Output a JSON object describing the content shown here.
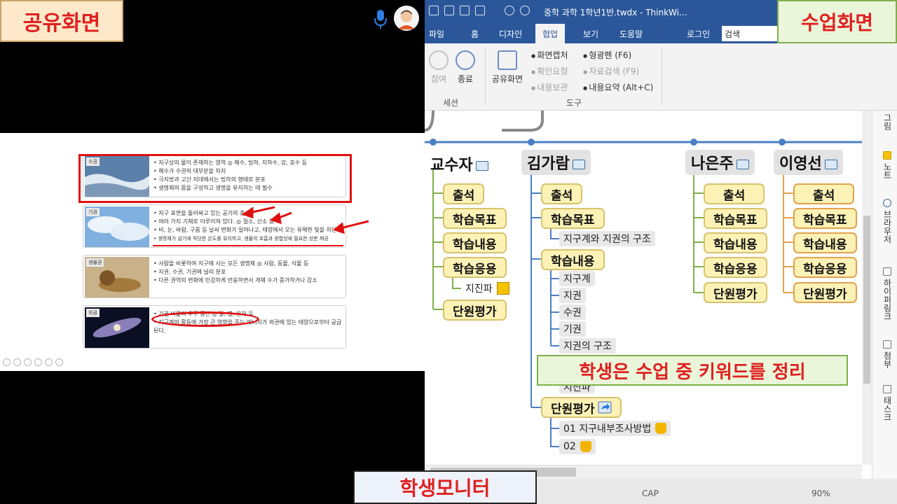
{
  "labels": {
    "share_screen": "공유화면",
    "class_screen": "수업화면",
    "student_monitor": "학생모니터",
    "keyword_note": "학생은 수업 중 키워드를 정리"
  },
  "app": {
    "title": "중학 과학 1학년1반.twdx - ThinkWi...",
    "menu": [
      "파일",
      "홈",
      "디자인",
      "협업",
      "보기",
      "도움말",
      "로그인"
    ],
    "active_menu": "협업",
    "search_placeholder": "검색",
    "ribbon": {
      "join": "참여",
      "end": "종료",
      "share_screen": "공유화면",
      "session_group": "세션",
      "tools_group": "도구",
      "tools": [
        {
          "label": "화면캡처",
          "enabled": true
        },
        {
          "label": "확인요청",
          "enabled": false
        },
        {
          "label": "내용보관",
          "enabled": false
        },
        {
          "label": "형광펜 (F6)",
          "enabled": true
        },
        {
          "label": "자료검색 (F9)",
          "enabled": false
        },
        {
          "label": "내용요약 (Alt+C)",
          "enabled": true
        }
      ]
    },
    "side_panel": [
      "그림",
      "노트",
      "브라우저",
      "하이퍼링크",
      "첨부",
      "태스크"
    ],
    "status": {
      "cap": "CAP",
      "zoom": "90%"
    }
  },
  "slide": {
    "cards": [
      {
        "tag": "수권",
        "lines": [
          "지구상의 물이 존재하는 영역 ◎ 해수, 빙하, 지하수, 강, 호수 등",
          "해수가 수권의 대부분을 차지",
          "극지방과 고산 지대에서는 빙하의 형태로 분포",
          "생명체의 몸을 구성하고 생명을 유지하는 데 필수"
        ]
      },
      {
        "tag": "기권",
        "lines": [
          "지구 표면을 둘러싸고 있는 공기의 층",
          "여러 가지 기체로 이루어져 있다. ◎ 질소, 산소 등",
          "비, 눈, 바람, 구름 등 날씨 변화가 일어나고, 태양에서 오는 유해한 빛을 차단",
          "생명체가 살기에 적당한 온도를 유지하고, 생물의 호흡과 광합성에 필요한 성분 제공"
        ]
      },
      {
        "tag": "생물권",
        "lines": [
          "사람을 비롯하여 지구에 사는 모든 생명체 ◎ 사람, 동물, 식물 등",
          "지권, 수권, 기권에 널리 분포",
          "다른 권역의 변화에 민감하게 반응하면서 개체 수가 증가하거나 감소"
        ]
      },
      {
        "tag": "외권",
        "lines": [
          "기권 바깥의 우주 공간 ◎ 달, 별, 은하 등",
          "지구계의 활동에 가장 큰 영향을 주는 에너지가 외권에 있는 태양으로부터 공급된다."
        ]
      }
    ]
  },
  "mindmap": {
    "columns": [
      {
        "name": "교수자",
        "nodes": [
          "출석",
          "학습목표",
          "학습내용",
          "학습응용",
          "단원평가"
        ],
        "leaf": "지진파"
      },
      {
        "name": "김가람",
        "nodes": [
          "출석",
          "학습목표",
          "학습내용",
          "단원평가"
        ],
        "goal_leaf": "지구계와 지권의 구조",
        "content_leaves": [
          "지구계",
          "지권",
          "수권",
          "기권",
          "지권의 구조",
          "지진파"
        ],
        "eval_leaves": [
          "01  지구내부조사방법",
          "02"
        ]
      },
      {
        "name": "나은주",
        "nodes": [
          "출석",
          "학습목표",
          "학습내용",
          "학습응용",
          "단원평가"
        ]
      },
      {
        "name": "이영선",
        "nodes": [
          "출석",
          "학습목표",
          "학습내용",
          "학습응용",
          "단원평가"
        ]
      }
    ]
  },
  "colors": {
    "ribbon_blue": "#2b579a",
    "node_fill": "#fdf2b6",
    "highlight_red": "#e01010"
  }
}
